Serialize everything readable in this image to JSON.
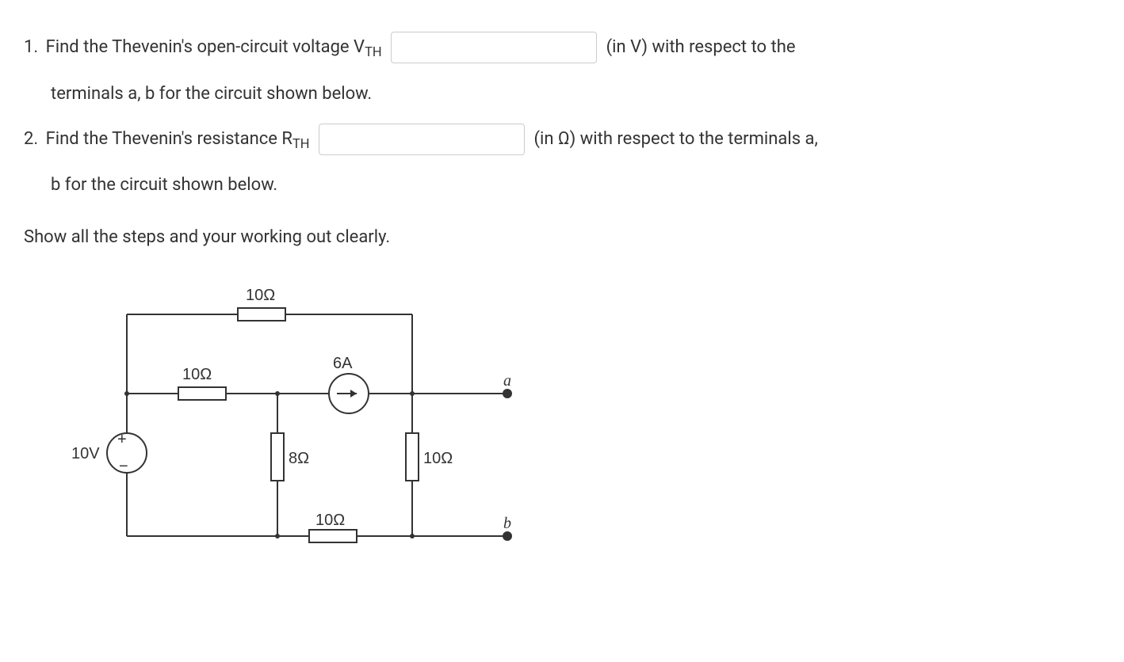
{
  "question1": {
    "number": "1.",
    "text_before": "Find the Thevenin's open-circuit voltage V",
    "subscript": "TH",
    "text_after": "(in V) with respect to the",
    "text_line2": "terminals a, b for the circuit shown below."
  },
  "question2": {
    "number": "2.",
    "text_before": "Find the Thevenin's resistance R",
    "subscript": "TH",
    "text_after": "(in Ω) with respect to the terminals a,",
    "text_line2": "b for the circuit shown below."
  },
  "instruction": "Show all the steps and your working out clearly.",
  "circuit": {
    "voltage_source": "10V",
    "current_source": "6A",
    "resistors": {
      "top": "10Ω",
      "left_mid": "10Ω",
      "center_vert": "8Ω",
      "right_vert": "10Ω",
      "bottom": "10Ω"
    },
    "terminals": {
      "a": "a",
      "b": "b"
    }
  }
}
